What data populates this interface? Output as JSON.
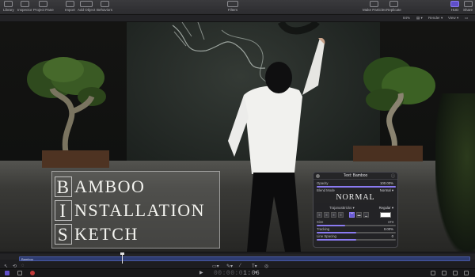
{
  "toolbar": {
    "left_labels": [
      "Library",
      "Inspector",
      "Project Pane"
    ],
    "import_label": "Import",
    "add_object_label": "Add Object",
    "behaviors_label": "Behaviors",
    "filters_label": "Filters",
    "make_particles_label": "Make Particles",
    "replicate_label": "Replicate",
    "hud_label": "HUD",
    "share_label": "Share"
  },
  "canvas_bar": {
    "zoom": "84%",
    "render": "Render",
    "view": "View"
  },
  "title": {
    "lines": [
      {
        "cap": "B",
        "rest": "AMBOO"
      },
      {
        "cap": "I",
        "rest": "NSTALLATION"
      },
      {
        "cap": "S",
        "rest": "KETCH"
      }
    ]
  },
  "hud": {
    "title": "Text: Bamboo",
    "opacity_label": "Opacity",
    "opacity_value": "100.00%",
    "opacity_fraction": 1.0,
    "blend_mode_label": "Blend Mode",
    "blend_mode_value": "Normal",
    "blend_display": "NORMAL",
    "font_name": "TrajanusBricks",
    "font_style": "Regular",
    "size_label": "Size",
    "size_value": "174",
    "tracking_label": "Tracking",
    "tracking_value": "0.00%",
    "line_spacing_label": "Line Spacing",
    "line_spacing_value": "0",
    "color_hex": "#ffffff"
  },
  "timeline": {
    "clip_name": "Bamboo",
    "timecode_dim": "00:00:0",
    "timecode_main": "1:06"
  },
  "colors": {
    "accent": "#6a5ad8",
    "clip": "#2e3c71",
    "title_text": "#f4f4f0"
  }
}
